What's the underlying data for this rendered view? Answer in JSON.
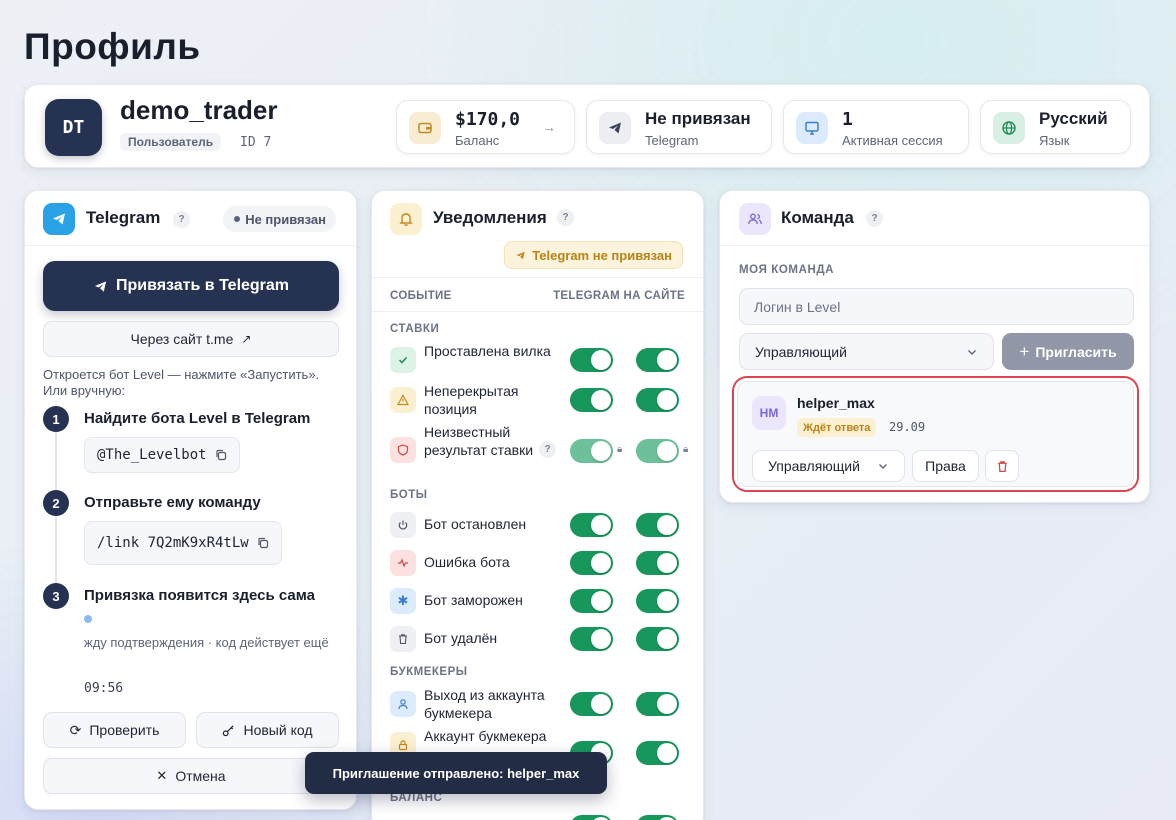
{
  "page": {
    "title": "Профиль"
  },
  "profile": {
    "avatar_initials": "DT",
    "username": "demo_trader",
    "role": "Пользователь",
    "id_label": "ID 7",
    "stats": [
      {
        "value": "$170,0",
        "label": "Баланс",
        "icon": "wallet-icon",
        "color": "#f3e4c4"
      },
      {
        "value": "Не привязан",
        "label": "Telegram",
        "icon": "send-icon",
        "color": "#eceef2"
      },
      {
        "value": "1",
        "label": "Активная сессия",
        "icon": "monitor-icon",
        "color": "#dcebfb"
      },
      {
        "value": "Русский",
        "label": "Язык",
        "icon": "globe-icon",
        "color": "#d8f0e3"
      }
    ]
  },
  "telegram": {
    "title": "Telegram",
    "status": "Не привязан",
    "link_button": "Привязать в Telegram",
    "site_button": "Через сайт t.me",
    "hint": "Откроется бот Level — нажмите «Запустить». Или вручную:",
    "steps": [
      {
        "num": "1",
        "title": "Найдите бота Level в Telegram",
        "code": "@The_Levelbot"
      },
      {
        "num": "2",
        "title": "Отправьте ему команду",
        "code": "/link 7Q2mK9xR4tLw"
      },
      {
        "num": "3",
        "title": "Привязка появится здесь сама"
      }
    ],
    "wait_text": "жду подтверждения · код действует ещё",
    "timer": "09:56",
    "check_button": "Проверить",
    "new_code_button": "Новый код",
    "cancel_button": "Отмена"
  },
  "notifications": {
    "title": "Уведомления",
    "warning": "Telegram не привязан",
    "col_event": "СОБЫТИЕ",
    "col_channels": "TELEGRAM НА САЙТЕ",
    "groups": {
      "bets": "СТАВКИ",
      "bots": "БОТЫ",
      "bookmakers": "БУКМЕКЕРЫ",
      "balance": "БАЛАНС"
    },
    "rows": {
      "r1": "Проставлена вилка",
      "r2": "Неперекрытая позиция",
      "r3": "Неизвестный результат ставки",
      "r4": "Бот остановлен",
      "r5": "Ошибка бота",
      "r6": "Бот заморожен",
      "r7": "Бот удалён",
      "r8": "Выход из аккаунта букмекера",
      "r9": "Аккаунт букмекера"
    }
  },
  "team": {
    "title": "Команда",
    "section": "МОЯ КОМАНДА",
    "login_placeholder": "Логин в Level",
    "role_select": "Управляющий",
    "invite_button": "Пригласить",
    "member": {
      "initials": "HM",
      "name": "helper_max",
      "status": "Ждёт ответа",
      "date": "29.09",
      "role": "Управляющий",
      "rights_button": "Права"
    }
  },
  "toast": "Приглашение отправлено: helper_max",
  "colors": {
    "primary": "#263252",
    "toggle_on": "#17975c",
    "warning": "#b98316",
    "highlight": "#d84650"
  }
}
